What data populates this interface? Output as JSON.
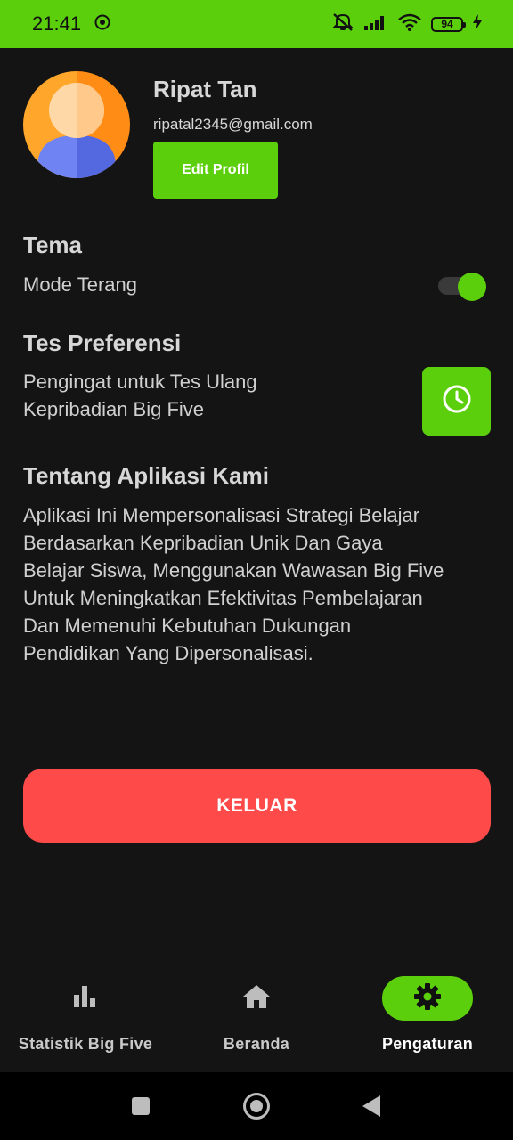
{
  "status_bar": {
    "time": "21:41",
    "battery": "94",
    "icons": [
      "whatsapp-icon",
      "mute-icon",
      "signal-icon",
      "wifi-icon",
      "battery-icon",
      "charging-icon"
    ]
  },
  "profile": {
    "name": "Ripat Tan",
    "email": "ripatal2345@gmail.com",
    "edit_label": "Edit Profil"
  },
  "theme": {
    "title": "Tema",
    "mode_label": "Mode Terang",
    "toggle_on": true
  },
  "preference": {
    "title": "Tes Preferensi",
    "reminder_line1": "Pengingat untuk Tes Ulang",
    "reminder_line2": "Kepribadian Big Five"
  },
  "about": {
    "title": "Tentang Aplikasi Kami",
    "lines": [
      "Aplikasi Ini Mempersonalisasi Strategi Belajar",
      "Berdasarkan Kepribadian Unik Dan Gaya",
      "Belajar Siswa, Menggunakan Wawasan Big Five",
      "Untuk Meningkatkan Efektivitas Pembelajaran",
      "Dan Memenuhi Kebutuhan Dukungan",
      "Pendidikan Yang Dipersonalisasi."
    ]
  },
  "logout_label": "KELUAR",
  "nav": {
    "items": [
      {
        "label": "Statistik Big Five",
        "icon": "bar-chart-icon",
        "active": false
      },
      {
        "label": "Beranda",
        "icon": "home-icon",
        "active": false
      },
      {
        "label": "Pengaturan",
        "icon": "gear-icon",
        "active": true
      }
    ]
  },
  "colors": {
    "accent": "#5ccf0c",
    "danger": "#ff4a4a",
    "background": "#141414"
  }
}
